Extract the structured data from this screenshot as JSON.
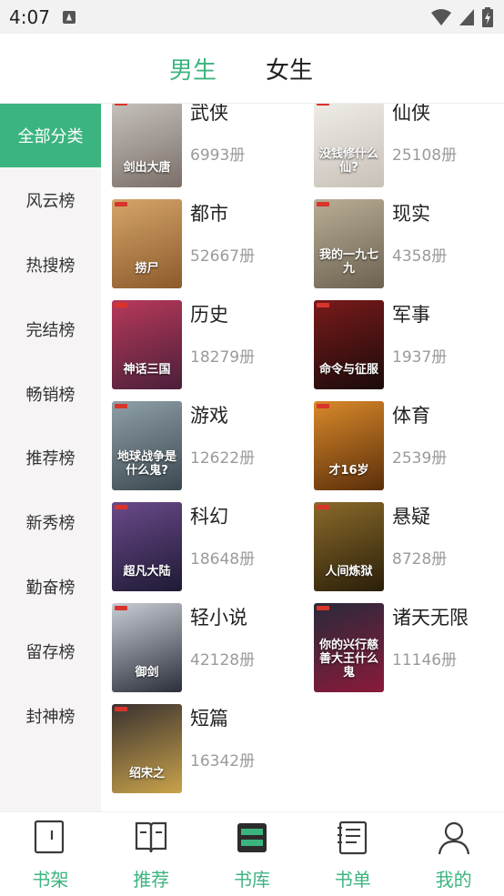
{
  "status": {
    "time": "4:07"
  },
  "header": {
    "tabs": [
      {
        "label": "男生"
      },
      {
        "label": "女生"
      }
    ]
  },
  "sidebar": {
    "items": [
      {
        "label": "全部分类"
      },
      {
        "label": "风云榜"
      },
      {
        "label": "热搜榜"
      },
      {
        "label": "完结榜"
      },
      {
        "label": "畅销榜"
      },
      {
        "label": "推荐榜"
      },
      {
        "label": "新秀榜"
      },
      {
        "label": "勤奋榜"
      },
      {
        "label": "留存榜"
      },
      {
        "label": "封神榜"
      }
    ]
  },
  "categories": [
    {
      "name": "武侠",
      "count": "6993册",
      "cover_text": "剑出大唐",
      "colors": [
        "#c9c4bf",
        "#7a6f68"
      ]
    },
    {
      "name": "仙侠",
      "count": "25108册",
      "cover_text": "没钱修什么仙?",
      "colors": [
        "#f0ede8",
        "#c8c1b8"
      ]
    },
    {
      "name": "都市",
      "count": "52667册",
      "cover_text": "捞尸",
      "colors": [
        "#d4a56a",
        "#8c5a2b"
      ]
    },
    {
      "name": "现实",
      "count": "4358册",
      "cover_text": "我的一九七九",
      "colors": [
        "#b9ad95",
        "#6c6250"
      ]
    },
    {
      "name": "历史",
      "count": "18279册",
      "cover_text": "神话三国",
      "colors": [
        "#b8395a",
        "#4a1f3a"
      ]
    },
    {
      "name": "军事",
      "count": "1937册",
      "cover_text": "命令与征服",
      "colors": [
        "#7a1a1a",
        "#1a0b0b"
      ]
    },
    {
      "name": "游戏",
      "count": "12622册",
      "cover_text": "地球战争是什么鬼?",
      "colors": [
        "#8fa0a8",
        "#3c4850"
      ]
    },
    {
      "name": "体育",
      "count": "2539册",
      "cover_text": "才16岁",
      "colors": [
        "#d9892a",
        "#5a2e0a"
      ]
    },
    {
      "name": "科幻",
      "count": "18648册",
      "cover_text": "超凡大陆",
      "colors": [
        "#6a4a8a",
        "#1f1a35"
      ]
    },
    {
      "name": "悬疑",
      "count": "8728册",
      "cover_text": "人间炼狱",
      "colors": [
        "#8a6a2a",
        "#2a1f0a"
      ]
    },
    {
      "name": "轻小说",
      "count": "42128册",
      "cover_text": "御剑",
      "colors": [
        "#c8ccd4",
        "#2a2f3a"
      ]
    },
    {
      "name": "诸天无限",
      "count": "11146册",
      "cover_text": "你的兴行慈善大王什么鬼",
      "colors": [
        "#2a2a3a",
        "#8a1a3a"
      ]
    },
    {
      "name": "短篇",
      "count": "16342册",
      "cover_text": "绍宋之",
      "colors": [
        "#3a3230",
        "#c9a24a"
      ]
    }
  ],
  "bottom_nav": {
    "items": [
      {
        "label": "书架",
        "icon": "bookshelf-icon"
      },
      {
        "label": "推荐",
        "icon": "book-open-icon"
      },
      {
        "label": "书库",
        "icon": "library-icon"
      },
      {
        "label": "书单",
        "icon": "booklist-icon"
      },
      {
        "label": "我的",
        "icon": "profile-icon"
      }
    ]
  },
  "colors": {
    "accent": "#3cb47f",
    "sidebar_bg": "#f6f4f5",
    "muted": "#9a9a9a"
  }
}
